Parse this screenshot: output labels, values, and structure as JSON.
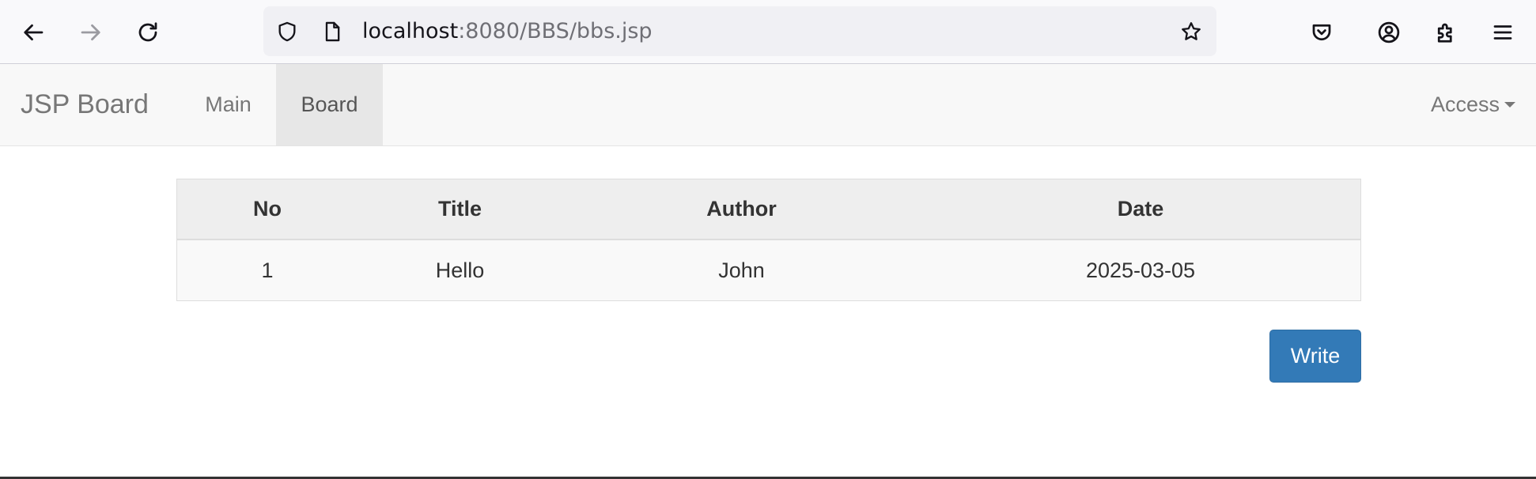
{
  "browser": {
    "url_host": "localhost",
    "url_path": ":8080/BBS/bbs.jsp"
  },
  "navbar": {
    "brand": "JSP Board",
    "items": [
      {
        "label": "Main",
        "active": false
      },
      {
        "label": "Board",
        "active": true
      }
    ],
    "dropdown_label": "Access"
  },
  "board": {
    "columns": [
      "No",
      "Title",
      "Author",
      "Date"
    ],
    "rows": [
      [
        "1",
        "Hello",
        "John",
        "2025-03-05"
      ]
    ],
    "write_label": "Write"
  },
  "colors": {
    "primary_button": "#337ab7",
    "navbar_bg": "#f8f8f8",
    "header_bg": "#eeeeee"
  }
}
